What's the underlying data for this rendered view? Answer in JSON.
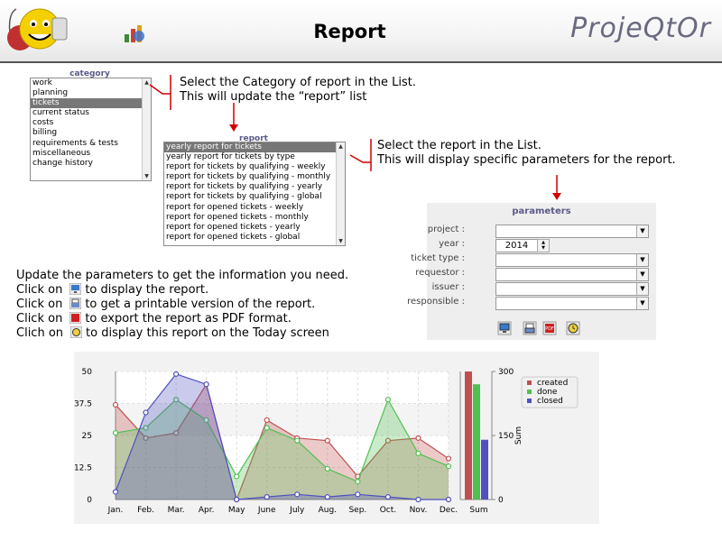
{
  "header": {
    "title": "Report",
    "brand": "ProjeQtOr"
  },
  "category_list": {
    "title": "category",
    "items": [
      "work",
      "planning",
      "tickets",
      "current status",
      "costs",
      "billing",
      "requirements & tests",
      "miscellaneous",
      "change history"
    ],
    "selected_index": 2
  },
  "report_list": {
    "title": "report",
    "items": [
      "yearly report for tickets",
      "yearly report for tickets by type",
      "report for tickets by qualifying - weekly",
      "report for tickets by qualifying - monthly",
      "report for tickets by qualifying - yearly",
      "report for tickets by qualifying - global",
      "report for opened tickets - weekly",
      "report for opened tickets - monthly",
      "report for opened tickets - yearly",
      "report for opened tickets - global"
    ],
    "selected_index": 0
  },
  "instruction1": {
    "line1": "Select the Category of report in the List.",
    "line2": "This will update the “report” list"
  },
  "instruction2": {
    "line1": "Select the report in the List.",
    "line2": "This will display specific parameters for the report."
  },
  "parameters": {
    "title": "parameters",
    "project_label": "project :",
    "year_label": "year :",
    "year_value": "2014",
    "ticket_type_label": "ticket type :",
    "requestor_label": "requestor :",
    "issuer_label": "issuer :",
    "responsible_label": "responsible :"
  },
  "hints": {
    "line1": "Update the parameters to get the information you need.",
    "line2_prefix": "Click on",
    "line2_suffix": "to display the report.",
    "line3_prefix": "Click on",
    "line3_suffix": "to get a printable version of the report.",
    "line4_prefix": "Click on",
    "line4_suffix": "to export the report as PDF format.",
    "line5_prefix": "Clich on",
    "line5_suffix": "to display this report on the Today screen"
  },
  "colors": {
    "created": "#c05050",
    "done": "#50c050",
    "closed": "#5050c0",
    "listbox_title": "#5a5a8a",
    "selected": "#777777"
  },
  "chart_data": {
    "type": "area",
    "categories": [
      "Jan.",
      "Feb.",
      "Mar.",
      "Apr.",
      "May",
      "June",
      "July",
      "Aug.",
      "Sep.",
      "Oct.",
      "Nov.",
      "Dec."
    ],
    "series": [
      {
        "name": "created",
        "values": [
          37,
          24,
          26,
          45,
          0,
          31,
          24,
          23,
          9,
          23,
          24,
          16
        ]
      },
      {
        "name": "done",
        "values": [
          26,
          28,
          39,
          31,
          9,
          28,
          23,
          12,
          7,
          39,
          18,
          13
        ]
      },
      {
        "name": "closed",
        "values": [
          3,
          34,
          49,
          45,
          0,
          1,
          2,
          1,
          2,
          1,
          0,
          0
        ]
      }
    ],
    "y_ticks": [
      "0",
      "12.5",
      "25",
      "37.5",
      "50"
    ],
    "ylim": [
      0,
      50
    ],
    "sum_axis": {
      "label": "Sum",
      "ticks": [
        "0",
        "150",
        "300"
      ],
      "ylim": [
        0,
        300
      ]
    },
    "sum_category": "Sum",
    "sum_values": [
      {
        "name": "created",
        "value": 300
      },
      {
        "name": "done",
        "value": 270
      },
      {
        "name": "closed",
        "value": 140
      }
    ],
    "legend": [
      "created",
      "done",
      "closed"
    ],
    "legend_position": "top-right",
    "grid": true
  }
}
